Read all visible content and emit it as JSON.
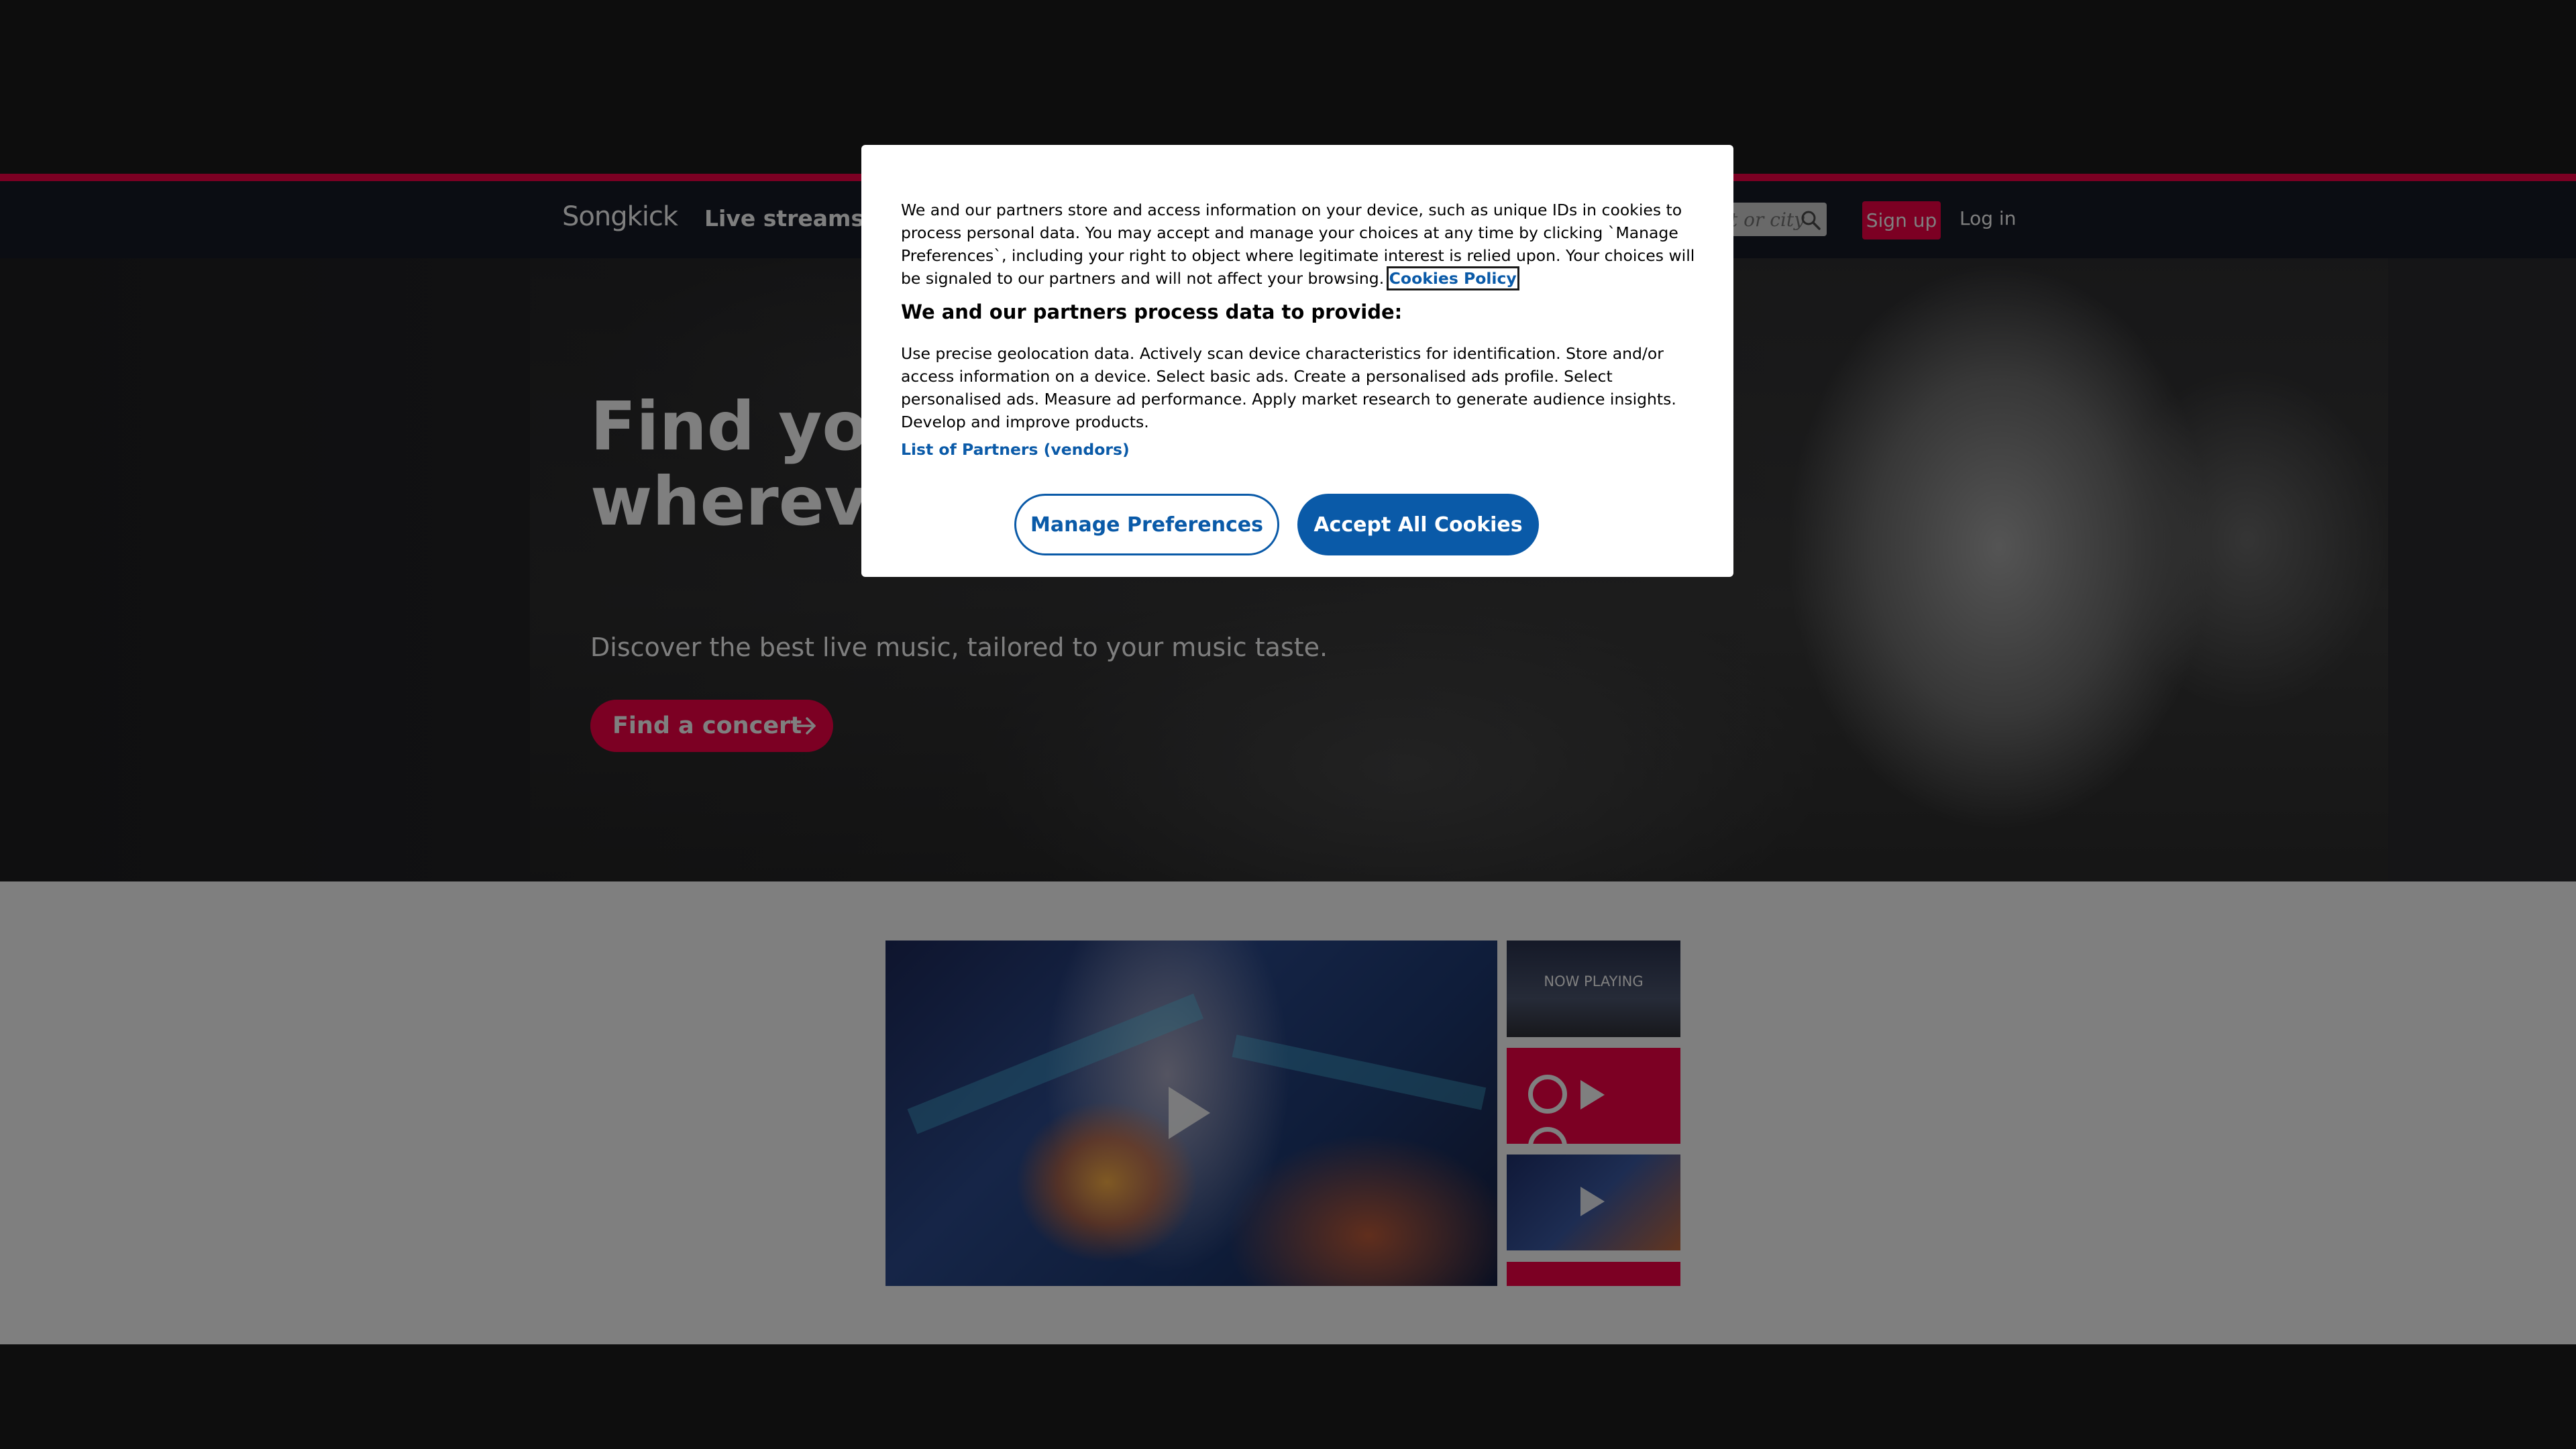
{
  "colors": {
    "brand": "#f80046",
    "navbar": "#161a27",
    "cookie_accent": "#0a5aa8"
  },
  "navbar": {
    "logo_text": "Songkick",
    "live_streams": "Live streams",
    "search_placeholder": "t or city",
    "search_icon": "search-icon",
    "signup": "Sign up",
    "login": "Log in"
  },
  "hero": {
    "title": "Find your next concert, wherever you are",
    "subtitle": "Discover the best live music, tailored to your music taste.",
    "cta": "Find a concert",
    "cta_icon": "arrow-right-icon"
  },
  "video": {
    "play_icon": "play-icon",
    "now_playing": "NOW PLAYING"
  },
  "cookie": {
    "intro": "We and our partners store and access information on your device, such as unique IDs in cookies to process personal data. You may accept and manage your choices at any time by clicking `Manage Preferences`, including your right to object where legitimate interest is relied upon. Your choices will be signaled to our partners and will not affect your browsing.",
    "policy_link": "Cookies Policy",
    "heading": "We and our partners process data to provide:",
    "purposes": "Use precise geolocation data. Actively scan device characteristics for identification. Store and/or access information on a device. Select basic ads. Create a personalised ads profile. Select personalised ads. Measure ad performance. Apply market research to generate audience insights. Develop and improve products.",
    "partners_link": "List of Partners (vendors)",
    "manage_button": "Manage Preferences",
    "accept_button": "Accept All Cookies"
  }
}
